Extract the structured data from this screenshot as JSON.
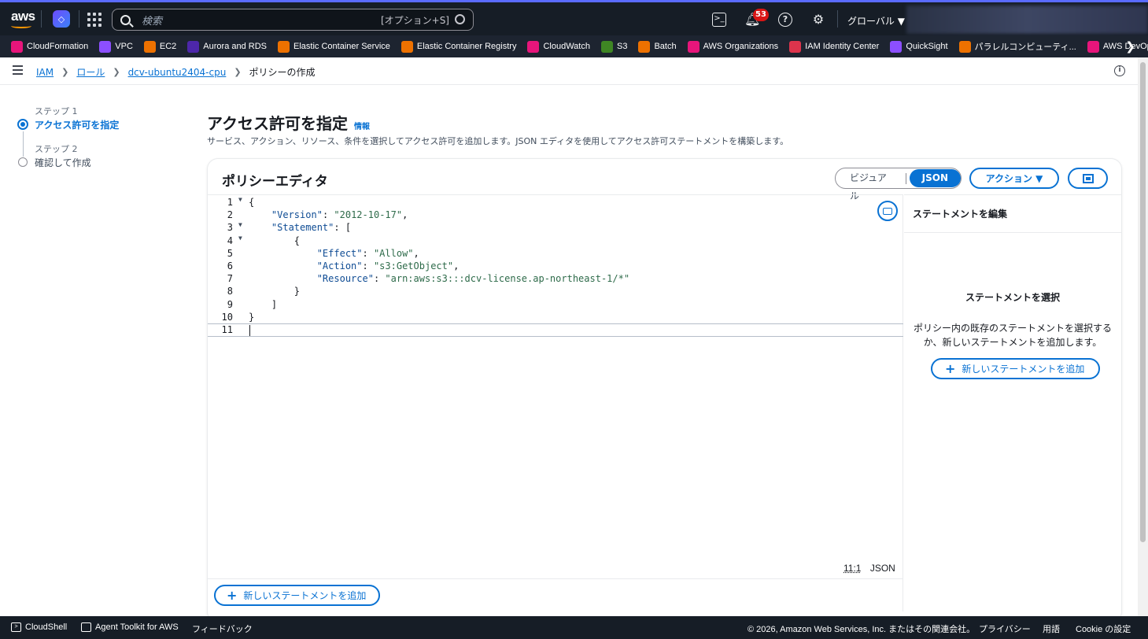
{
  "topnav": {
    "logo": "aws",
    "search_placeholder": "検索",
    "search_shortcut": "[オプション+S]",
    "notifications_count": "53",
    "region": "グローバル ▼",
    "icons": [
      "q-developer-icon",
      "apps-grid-icon",
      "search-icon",
      "cloudshell-icon",
      "bell-icon",
      "help-icon",
      "gear-icon"
    ]
  },
  "favorites": [
    {
      "label": "CloudFormation",
      "color": "#e7157b"
    },
    {
      "label": "VPC",
      "color": "#8c4fff"
    },
    {
      "label": "EC2",
      "color": "#ed7100"
    },
    {
      "label": "Aurora and RDS",
      "color": "#4d27aa"
    },
    {
      "label": "Elastic Container Service",
      "color": "#ed7100"
    },
    {
      "label": "Elastic Container Registry",
      "color": "#ed7100"
    },
    {
      "label": "CloudWatch",
      "color": "#e7157b"
    },
    {
      "label": "S3",
      "color": "#3f8624"
    },
    {
      "label": "Batch",
      "color": "#ed7100"
    },
    {
      "label": "AWS Organizations",
      "color": "#e7157b"
    },
    {
      "label": "IAM Identity Center",
      "color": "#dd344c"
    },
    {
      "label": "QuickSight",
      "color": "#8c4fff"
    },
    {
      "label": "パラレルコンピューティ...",
      "color": "#ed7100"
    },
    {
      "label": "AWS DevOps Ag",
      "color": "#e7157b"
    }
  ],
  "breadcrumb": {
    "items": [
      "IAM",
      "ロール",
      "dcv-ubuntu2404-cpu"
    ],
    "current": "ポリシーの作成"
  },
  "steps": [
    {
      "small": "ステップ 1",
      "label": "アクセス許可を指定"
    },
    {
      "small": "ステップ 2",
      "label": "確認して作成"
    }
  ],
  "main": {
    "title": "アクセス許可を指定",
    "info": "情報",
    "description": "サービス、アクション、リソース、条件を選択してアクセス許可を追加します。JSON エディタを使用してアクセス許可ステートメントを構築します。"
  },
  "editor": {
    "title": "ポリシーエディタ",
    "mode_visual": "ビジュアル",
    "mode_json": "JSON",
    "actions_label": "アクション ▼",
    "status_position": "11:1",
    "status_lang": "JSON",
    "add_statement": "新しいステートメントを追加",
    "lines": [
      {
        "n": "1",
        "fold": true,
        "text": "{"
      },
      {
        "n": "2",
        "fold": false,
        "indent": "    ",
        "key": "\"Version\"",
        "sep": ": ",
        "val": "\"2012-10-17\"",
        "tail": ","
      },
      {
        "n": "3",
        "fold": true,
        "indent": "    ",
        "key": "\"Statement\"",
        "sep": ": ",
        "tail": "["
      },
      {
        "n": "4",
        "fold": true,
        "text": "        {"
      },
      {
        "n": "5",
        "fold": false,
        "indent": "            ",
        "key": "\"Effect\"",
        "sep": ": ",
        "val": "\"Allow\"",
        "tail": ","
      },
      {
        "n": "6",
        "fold": false,
        "indent": "            ",
        "key": "\"Action\"",
        "sep": ": ",
        "val": "\"s3:GetObject\"",
        "tail": ","
      },
      {
        "n": "7",
        "fold": false,
        "indent": "            ",
        "key": "\"Resource\"",
        "sep": ": ",
        "val": "\"arn:aws:s3:::dcv-license.ap-northeast-1/*\"",
        "tail": ""
      },
      {
        "n": "8",
        "fold": false,
        "text": "        }"
      },
      {
        "n": "9",
        "fold": false,
        "text": "    ]"
      },
      {
        "n": "10",
        "fold": false,
        "text": "}"
      },
      {
        "n": "11",
        "fold": false,
        "text": ""
      }
    ]
  },
  "side_panel": {
    "title": "ステートメントを編集",
    "heading": "ステートメントを選択",
    "body": "ポリシー内の既存のステートメントを選択するか、新しいステートメントを追加します。",
    "add_statement": "新しいステートメントを追加"
  },
  "footer": {
    "cloudshell": "CloudShell",
    "agent_toolkit": "Agent Toolkit for AWS",
    "feedback": "フィードバック",
    "copyright": "© 2026, Amazon Web Services, Inc. またはその関連会社。",
    "privacy": "プライバシー",
    "terms": "用語",
    "cookie": "Cookie の設定"
  }
}
